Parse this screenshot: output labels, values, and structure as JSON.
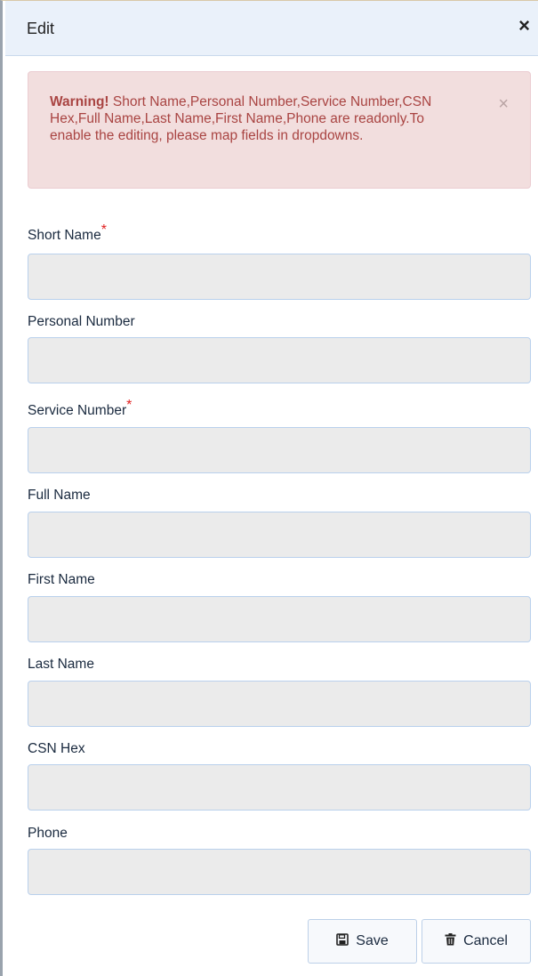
{
  "dialog": {
    "title": "Edit",
    "close_glyph": "×"
  },
  "warning": {
    "strong": "Warning!",
    "message": " Short Name,Personal Number,Service Number,CSN Hex,Full Name,Last Name,First Name,Phone are readonly.To enable the editing, please map fields in dropdowns.",
    "close_glyph": "×"
  },
  "fields": {
    "short_name": {
      "label": "Short Name",
      "required_mark": "*",
      "value": ""
    },
    "personal_number": {
      "label": "Personal Number",
      "value": ""
    },
    "service_number": {
      "label": "Service Number",
      "required_mark": "*",
      "value": ""
    },
    "full_name": {
      "label": "Full Name",
      "value": ""
    },
    "first_name": {
      "label": "First Name",
      "value": ""
    },
    "last_name": {
      "label": "Last Name",
      "value": ""
    },
    "csn_hex": {
      "label": "CSN Hex",
      "value": ""
    },
    "phone": {
      "label": "Phone",
      "value": ""
    }
  },
  "buttons": {
    "save": {
      "label": "Save",
      "icon": "floppy-disk-icon"
    },
    "cancel": {
      "label": "Cancel",
      "icon": "trash-icon"
    }
  },
  "colors": {
    "header_bg": "#eaf1fa",
    "warning_bg": "#f2dede",
    "warning_text": "#a94442",
    "required": "#e02020",
    "input_bg": "#ebebeb"
  }
}
